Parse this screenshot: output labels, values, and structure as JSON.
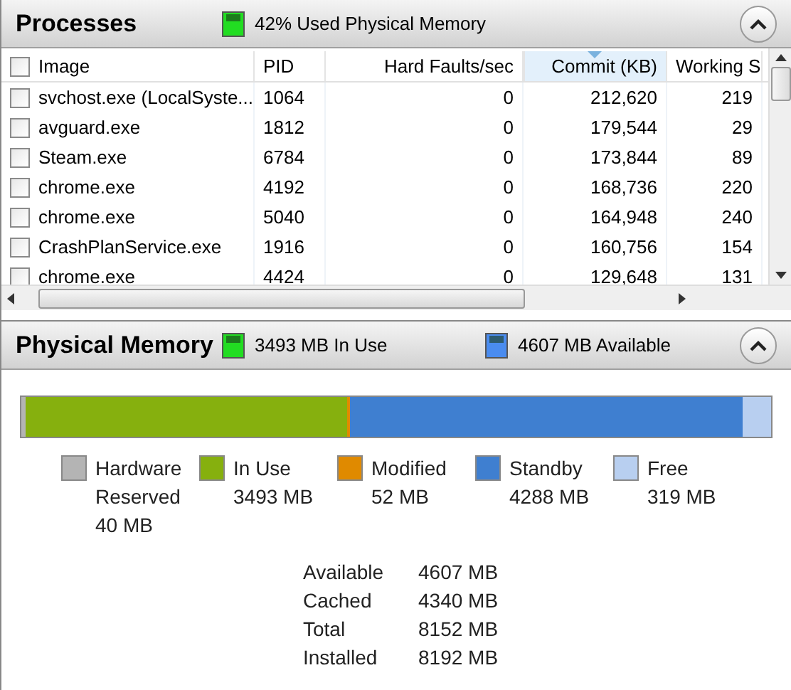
{
  "processes": {
    "title": "Processes",
    "summary": "42% Used Physical Memory",
    "expanded": true,
    "columns": [
      {
        "label": "Image",
        "sorted": false
      },
      {
        "label": "PID",
        "sorted": false
      },
      {
        "label": "Hard Faults/sec",
        "sorted": false
      },
      {
        "label": "Commit (KB)",
        "sorted": true
      },
      {
        "label": "Working S",
        "sorted": false
      }
    ],
    "rows": [
      {
        "checked": false,
        "cells": [
          "svchost.exe (LocalSyste...",
          "1064",
          "0",
          "212,620",
          "219"
        ]
      },
      {
        "checked": false,
        "cells": [
          "avguard.exe",
          "1812",
          "0",
          "179,544",
          "29"
        ]
      },
      {
        "checked": false,
        "cells": [
          "Steam.exe",
          "6784",
          "0",
          "173,844",
          "89"
        ]
      },
      {
        "checked": false,
        "cells": [
          "chrome.exe",
          "4192",
          "0",
          "168,736",
          "220"
        ]
      },
      {
        "checked": false,
        "cells": [
          "chrome.exe",
          "5040",
          "0",
          "164,948",
          "240"
        ]
      },
      {
        "checked": false,
        "cells": [
          "CrashPlanService.exe",
          "1916",
          "0",
          "160,756",
          "154"
        ]
      },
      {
        "checked": false,
        "cells": [
          "chrome.exe",
          "4424",
          "0",
          "129,648",
          "131"
        ]
      }
    ]
  },
  "physical_memory": {
    "title": "Physical Memory",
    "in_use": "3493 MB In Use",
    "available": "4607 MB Available",
    "expanded": true,
    "legend": [
      {
        "label": "Hardware Reserved",
        "value": "40 MB",
        "color": "#b4b4b4"
      },
      {
        "label": "In Use",
        "value": "3493 MB",
        "color": "#86b00e"
      },
      {
        "label": "Modified",
        "value": "52 MB",
        "color": "#e08a00"
      },
      {
        "label": "Standby",
        "value": "4288 MB",
        "color": "#3f7fd0"
      },
      {
        "label": "Free",
        "value": "319 MB",
        "color": "#b8cff0"
      }
    ],
    "stats": [
      {
        "label": "Available",
        "value": "4607 MB"
      },
      {
        "label": "Cached",
        "value": "4340 MB"
      },
      {
        "label": "Total",
        "value": "8152 MB"
      },
      {
        "label": "Installed",
        "value": "8192 MB"
      }
    ]
  }
}
